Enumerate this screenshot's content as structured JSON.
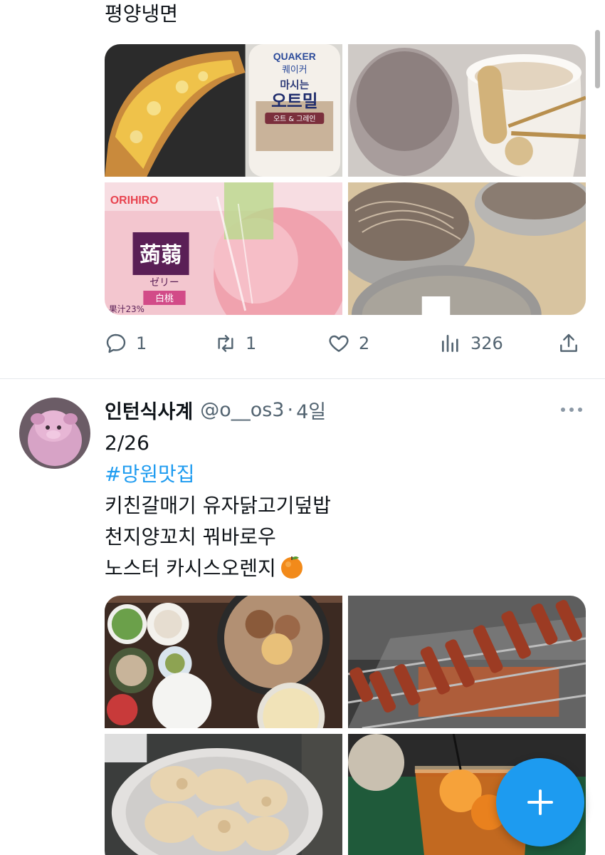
{
  "top_tweet": {
    "text_tail": "평양냉면",
    "actions": {
      "reply_count": "1",
      "retweet_count": "1",
      "like_count": "2",
      "views_count": "326"
    }
  },
  "tweet": {
    "display_name": "인턴식사계",
    "handle": "@o__os3",
    "separator": "·",
    "time": "4일",
    "lines": [
      "2/26",
      "#망원맛집",
      "키친갈매기 유자닭고기덮밥",
      "천지양꼬치 꿔바로우",
      "노스터 카시스오렌지"
    ]
  },
  "images": {
    "grid1": [
      {
        "pkg_brand": "QUAKER",
        "pkg_sub": "퀘이커",
        "pkg_title": "마시는",
        "pkg_title2": "오트밀",
        "pkg_flavor": "오트 & 그레인"
      },
      {},
      {
        "pkg_brand": "ORIHIRO",
        "pkg_title": "蒟蒻",
        "pkg_sub": "ゼリー",
        "pkg_flavor": "白桃",
        "pkg_juice": "果汁23%"
      },
      {}
    ]
  },
  "colors": {
    "accent": "#1d9bf0",
    "secondary_text": "#536471",
    "divider": "#e6e9ec"
  },
  "icons": [
    "reply-icon",
    "retweet-icon",
    "like-icon",
    "views-icon",
    "share-icon",
    "more-icon",
    "compose-icon",
    "orange-emoji"
  ]
}
